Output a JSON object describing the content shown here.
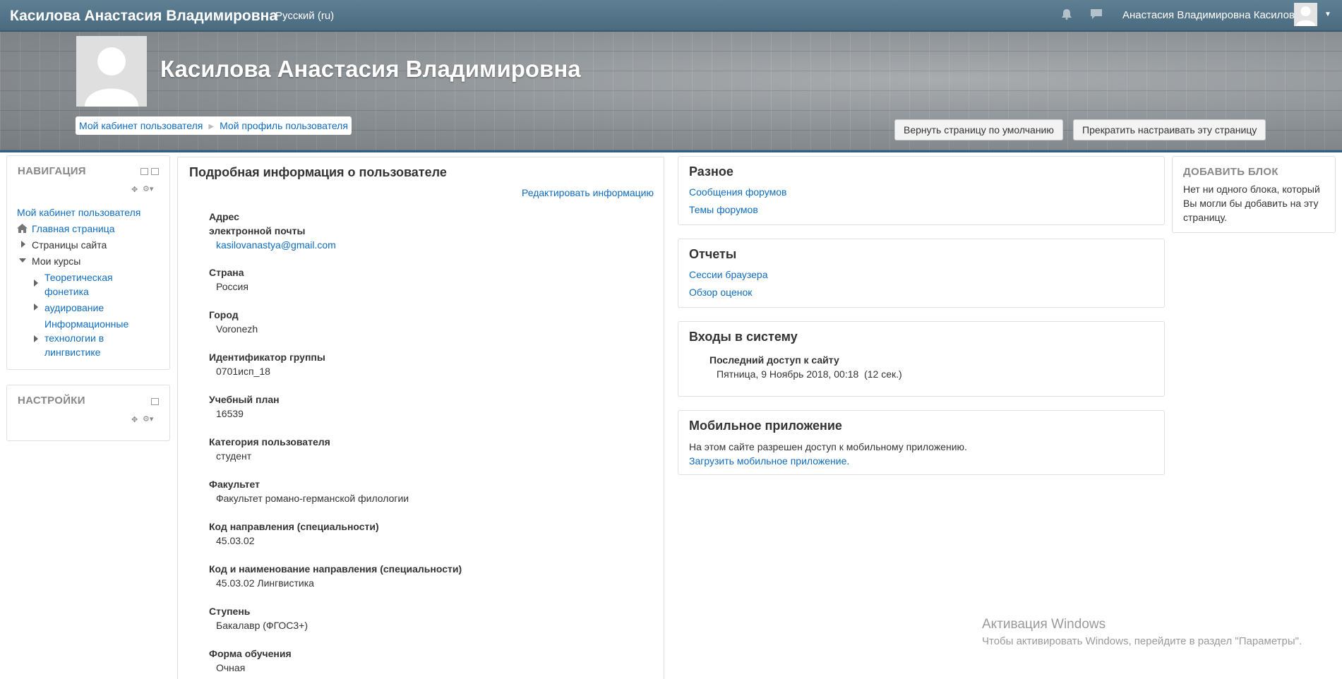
{
  "navbar": {
    "site_title": "Касилова Анастасия Владимировна",
    "language": "Русский (ru)",
    "user_name": "Анастасия Владимировна Касилова",
    "icons": [
      "bell-icon",
      "chat-icon",
      "avatar-icon",
      "caret-down-icon"
    ]
  },
  "header": {
    "full_name": "Касилова Анастасия Владимировна",
    "breadcrumb": [
      "Мой кабинет пользователя",
      "Мой профиль пользователя"
    ],
    "reset_button": "Вернуть страницу по умолчанию",
    "stop_customize_button": "Прекратить настраивать эту страницу"
  },
  "navigation": {
    "title": "НАВИГАЦИЯ",
    "dashboard": "Мой кабинет пользователя",
    "home": "Главная страница",
    "site_pages": "Страницы сайта",
    "my_courses": "Мои курсы",
    "courses": [
      {
        "line1": "Теоретическая",
        "line2": "фонетика",
        "line3": ""
      },
      {
        "line1": "аудирование",
        "line2": "",
        "line3": ""
      },
      {
        "line1": "Информационные",
        "line2": "технологии в",
        "line3": "лингвистике"
      }
    ]
  },
  "settings_block": {
    "title": "НАСТРОЙКИ"
  },
  "profile": {
    "title": "Подробная информация о пользователе",
    "edit_link": "Редактировать информацию",
    "email_label_1": "Адрес",
    "email_label_2": "электронной почты",
    "email_value": "kasilovanastya@gmail.com",
    "fields": [
      {
        "label": "Страна",
        "value": "Россия"
      },
      {
        "label": "Город",
        "value": "Voronezh"
      },
      {
        "label": "Идентификатор группы",
        "value": "0701исп_18"
      },
      {
        "label": "Учебный план",
        "value": "16539"
      },
      {
        "label": "Категория пользователя",
        "value": "студент"
      },
      {
        "label": "Факультет",
        "value": "Факультет романо-германской филологии"
      },
      {
        "label": "Код направления (специальности)",
        "value": "45.03.02"
      },
      {
        "label": "Код и наименование направления (специальности)",
        "value": "45.03.02 Лингвистика"
      },
      {
        "label": "Ступень",
        "value": "Бакалавр (ФГОС3+)"
      },
      {
        "label": "Форма обучения",
        "value": "Очная"
      }
    ]
  },
  "misc": {
    "title": "Разное",
    "links": [
      "Сообщения форумов",
      "Темы форумов"
    ]
  },
  "reports": {
    "title": "Отчеты",
    "links": [
      "Сессии браузера",
      "Обзор оценок"
    ]
  },
  "logins": {
    "title": "Входы в систему",
    "last_access_label": "Последний доступ к сайту",
    "last_access_value": "Пятница, 9 Ноябрь 2018, 00:18  (12 сек.)"
  },
  "mobile": {
    "title": "Мобильное приложение",
    "text": "На этом сайте разрешен доступ к мобильному приложению.",
    "link": "Загрузить мобильное приложение."
  },
  "add_block": {
    "title": "ДОБАВИТЬ БЛОК",
    "line1": "Нет ни одного блока, который",
    "line2": "Вы могли бы добавить на эту",
    "line3": "страницу."
  },
  "watermark": {
    "line1": "Активация Windows",
    "line2": "Чтобы активировать Windows, перейдите в раздел \"Параметры\"."
  }
}
